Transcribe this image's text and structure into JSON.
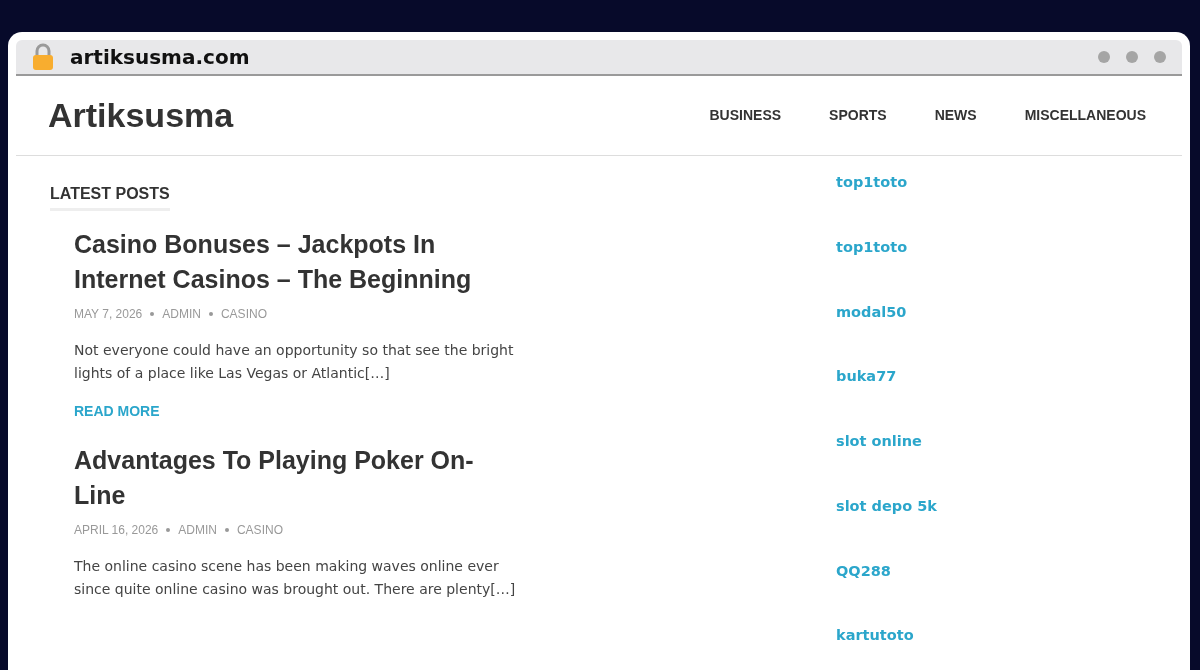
{
  "browser": {
    "address": "artiksusma.com"
  },
  "site": {
    "title": "Artiksusma",
    "nav": [
      {
        "label": "BUSINESS"
      },
      {
        "label": "SPORTS"
      },
      {
        "label": "NEWS"
      },
      {
        "label": "MISCELLANEOUS"
      }
    ]
  },
  "section_title": "LATEST POSTS",
  "posts": [
    {
      "title": "Casino Bonuses – Jackpots In Internet Casinos – The Beginning",
      "date": "MAY 7, 2026",
      "author": "ADMIN",
      "category": "CASINO",
      "excerpt": "Not everyone could have an opportunity so that see the bright lights of a place like Las Vegas or Atlantic[…]",
      "read_more": "READ MORE"
    },
    {
      "title": "Advantages To Playing Poker On-Line",
      "date": "APRIL 16, 2026",
      "author": "ADMIN",
      "category": "CASINO",
      "excerpt": "The online casino scene has been making waves online ever since quite online casino was brought out. There are plenty[…]"
    }
  ],
  "sidebar_links": [
    "top1toto",
    "top1toto",
    "modal50",
    "buka77",
    "slot online",
    "slot depo 5k",
    "QQ288",
    "kartutoto"
  ]
}
